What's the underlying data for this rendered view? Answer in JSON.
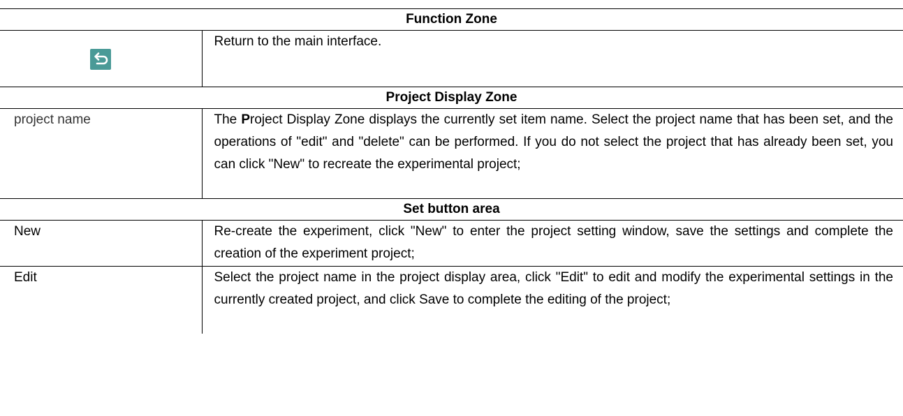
{
  "sections": {
    "function_zone": {
      "title": "Function Zone",
      "rows": [
        {
          "icon": "return-icon",
          "description": "Return to the main interface."
        }
      ]
    },
    "project_display_zone": {
      "title": "Project Display Zone",
      "rows": [
        {
          "label": "project name",
          "description_first_letter": "P",
          "description_prefix": "The ",
          "description_rest": "roject Display Zone displays the currently set item name. Select the project name that has been set, and the operations of \"edit\" and \"delete\" can be performed. If you do not select the project that has already been set, you can click \"New\" to recreate the experimental project;"
        }
      ]
    },
    "set_button_area": {
      "title": "Set button area",
      "rows": [
        {
          "label": "New",
          "description": "Re-create the experiment, click \"New\" to enter the project setting window, save the settings and complete the creation of the experiment project;"
        },
        {
          "label": "Edit",
          "description": "Select the project name in the project display area, click \"Edit\" to edit and modify the experimental settings in the currently created project, and click Save to complete the editing of the project;"
        }
      ]
    }
  },
  "colors": {
    "icon_bg": "#4a9a97",
    "icon_fg": "#ffffff"
  }
}
